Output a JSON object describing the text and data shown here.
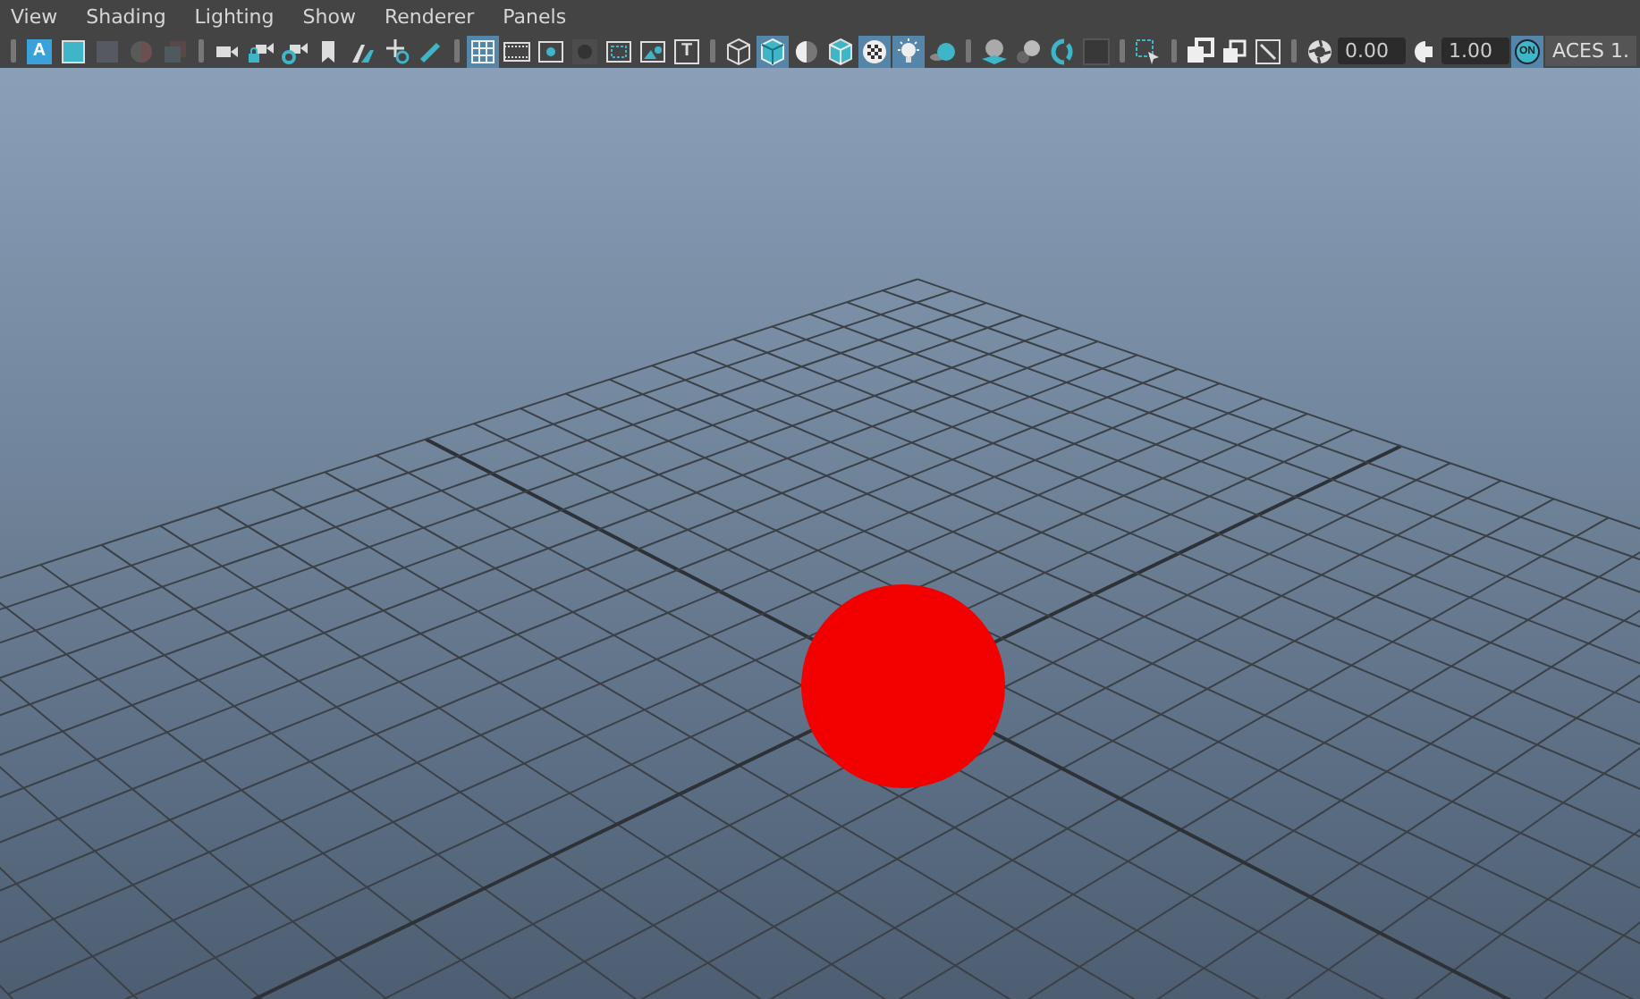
{
  "menu": [
    "View",
    "Shading",
    "Lighting",
    "Show",
    "Renderer",
    "Panels"
  ],
  "toolbar": [
    {
      "kind": "separator"
    },
    {
      "kind": "letter-badge",
      "label": "A",
      "selected": false
    },
    {
      "kind": "frame",
      "selected": false
    },
    {
      "kind": "dim-square",
      "selected": false
    },
    {
      "kind": "dim-sphere",
      "selected": false
    },
    {
      "kind": "dim-layers",
      "selected": false
    },
    {
      "kind": "separator"
    },
    {
      "kind": "camera",
      "selected": false
    },
    {
      "kind": "camera-lock",
      "selected": false
    },
    {
      "kind": "camera-gear",
      "selected": false
    },
    {
      "kind": "bookmark",
      "selected": false
    },
    {
      "kind": "plane",
      "selected": false
    },
    {
      "kind": "move",
      "selected": false
    },
    {
      "kind": "pencil",
      "selected": false
    },
    {
      "kind": "separator"
    },
    {
      "kind": "grid",
      "selected": true
    },
    {
      "kind": "film",
      "selected": false
    },
    {
      "kind": "res-gate",
      "selected": false
    },
    {
      "kind": "dark-circle",
      "selected": false
    },
    {
      "kind": "safe-action",
      "selected": false
    },
    {
      "kind": "safe-title",
      "selected": false
    },
    {
      "kind": "letter",
      "label": "T",
      "selected": false
    },
    {
      "kind": "separator"
    },
    {
      "kind": "wire-cube",
      "selected": false
    },
    {
      "kind": "shaded-cube",
      "selected": true
    },
    {
      "kind": "half-sphere",
      "selected": false
    },
    {
      "kind": "wire-shaded-cube",
      "selected": false
    },
    {
      "kind": "checker",
      "selected": true
    },
    {
      "kind": "light",
      "selected": true
    },
    {
      "kind": "shadow-sphere",
      "selected": false
    },
    {
      "kind": "separator"
    },
    {
      "kind": "ao",
      "selected": false
    },
    {
      "kind": "motion-blur",
      "selected": false
    },
    {
      "kind": "ring",
      "selected": false
    },
    {
      "kind": "dark-square",
      "selected": false
    },
    {
      "kind": "separator"
    },
    {
      "kind": "select-box",
      "selected": false
    },
    {
      "kind": "separator"
    },
    {
      "kind": "isolate",
      "selected": false
    },
    {
      "kind": "xray",
      "selected": false
    },
    {
      "kind": "pencil-square",
      "selected": false
    },
    {
      "kind": "separator"
    },
    {
      "kind": "aperture",
      "selected": false
    },
    {
      "kind": "field",
      "value": "0.00"
    },
    {
      "kind": "half-circle",
      "selected": false
    },
    {
      "kind": "field",
      "value": "1.00"
    },
    {
      "kind": "toggle",
      "label": "ON",
      "selected": true
    },
    {
      "kind": "dropdown",
      "label": "ACES 1."
    }
  ]
}
